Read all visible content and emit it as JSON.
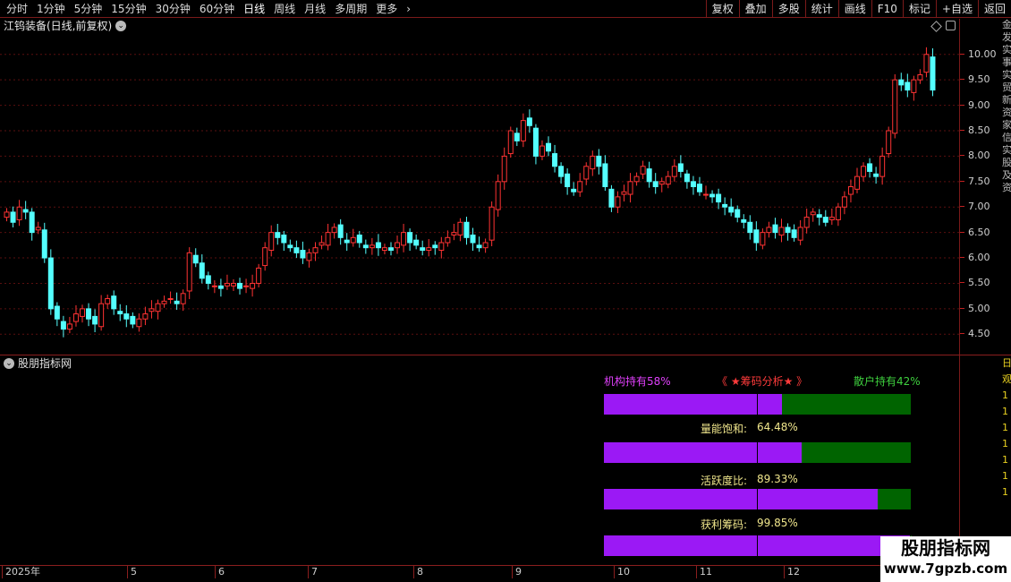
{
  "toolbar": {
    "periods": [
      "分时",
      "1分钟",
      "5分钟",
      "15分钟",
      "30分钟",
      "60分钟",
      "日线",
      "周线",
      "月线",
      "多周期",
      "更多"
    ],
    "active_period": "日线",
    "more_arrow": "›",
    "buttons": [
      "复权",
      "叠加",
      "多股",
      "统计",
      "画线",
      "F10",
      "标记",
      "+自选",
      "返回"
    ]
  },
  "chart": {
    "stock_title": "江钨装备(日线,前复权)",
    "y_ticks": [
      "10.00",
      "9.50",
      "9.00",
      "8.50",
      "8.00",
      "7.50",
      "7.00",
      "6.50",
      "6.00",
      "5.50",
      "5.00",
      "4.50"
    ],
    "side_text": "金发实事实贸新资家信实股及资",
    "colors": {
      "up": "#ff3333",
      "down": "#54ffff",
      "grid": "#5a0f0f"
    }
  },
  "chart_data": {
    "type": "candlestick",
    "ylim": [
      4.1,
      10.7
    ],
    "months": [
      "2025年",
      "5",
      "6",
      "7",
      "8",
      "9",
      "10",
      "11",
      "12"
    ],
    "close_series": [
      6.9,
      6.7,
      7.0,
      6.9,
      6.5,
      6.6,
      6.0,
      5.0,
      4.8,
      4.6,
      4.7,
      4.9,
      5.0,
      4.8,
      4.7,
      5.1,
      5.2,
      5.0,
      4.9,
      4.8,
      4.7,
      4.8,
      4.9,
      5.0,
      5.1,
      5.15,
      5.2,
      5.1,
      5.3,
      6.1,
      5.9,
      5.6,
      5.5,
      5.45,
      5.4,
      5.5,
      5.5,
      5.4,
      5.45,
      5.5,
      5.8,
      6.2,
      6.5,
      6.4,
      6.3,
      6.2,
      6.1,
      6.0,
      6.1,
      6.2,
      6.3,
      6.5,
      6.6,
      6.4,
      6.3,
      6.4,
      6.3,
      6.2,
      6.25,
      6.2,
      6.2,
      6.15,
      6.3,
      6.5,
      6.3,
      6.25,
      6.15,
      6.2,
      6.2,
      6.3,
      6.4,
      6.5,
      6.7,
      6.4,
      6.3,
      6.2,
      6.3,
      7.0,
      7.5,
      8.0,
      8.5,
      8.3,
      8.7,
      8.6,
      8.0,
      8.2,
      8.1,
      7.8,
      7.6,
      7.4,
      7.3,
      7.5,
      7.8,
      8.0,
      7.8,
      7.4,
      7.0,
      7.2,
      7.3,
      7.5,
      7.6,
      7.8,
      7.5,
      7.4,
      7.5,
      7.6,
      7.8,
      7.7,
      7.5,
      7.4,
      7.3,
      7.25,
      7.2,
      7.1,
      7.0,
      6.9,
      6.8,
      6.7,
      6.5,
      6.3,
      6.5,
      6.6,
      6.5,
      6.6,
      6.5,
      6.4,
      6.6,
      6.8,
      6.9,
      6.8,
      6.7,
      6.8,
      7.0,
      7.2,
      7.4,
      7.6,
      7.8,
      7.7,
      7.6,
      8.0,
      8.5,
      9.5,
      9.4,
      9.3,
      9.5,
      9.6,
      10.0,
      9.3
    ],
    "indicator": {
      "institution_label": "机构持有58%",
      "chip_title": "《 ★筹码分析★ 》",
      "retail_label": "散户持有42%",
      "institution_pct": 58,
      "bars": [
        {
          "label": "量能饱和:",
          "value": "64.48%",
          "pct": 64.48
        },
        {
          "label": "活跃度比:",
          "value": "89.33%",
          "pct": 89.33
        },
        {
          "label": "获利筹码:",
          "value": "99.85%",
          "pct": 99.85
        }
      ]
    }
  },
  "sub_panel": {
    "title": "股朋指标网",
    "side_text": "日观1111111"
  },
  "watermark": {
    "title": "股朋指标网",
    "url": "www.7gpzb.com"
  }
}
